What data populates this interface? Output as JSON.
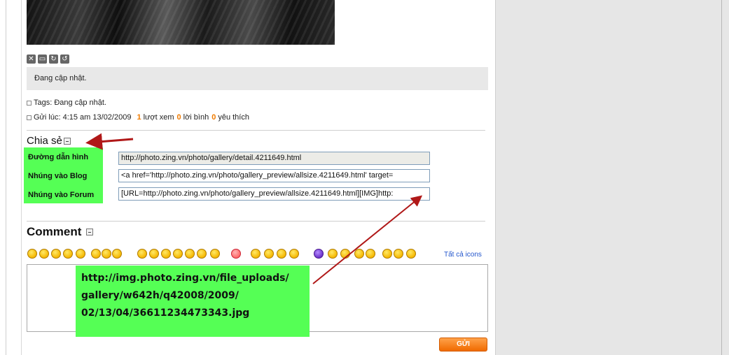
{
  "photo": {
    "description": ""
  },
  "toolbar_icons": [
    "close-icon",
    "image-icon",
    "rotate-icon",
    "refresh-icon"
  ],
  "toolbar_glyphs": [
    "✕",
    "▭",
    "↻",
    "↺"
  ],
  "description": "Đang cập nhật.",
  "tags": "Tags: Đang cập nhật.",
  "posted": {
    "label": "Gửi lúc: 4:15 am 13/02/2009",
    "views_count": "1",
    "views_label": "lượt xem",
    "comments_count": "0",
    "comments_label": "lời bình",
    "likes_count": "0",
    "likes_label": "yêu thích"
  },
  "share": {
    "title": "Chia sẻ",
    "rows": [
      {
        "label": "Đường dẫn hình",
        "value": "http://photo.zing.vn/photo/gallery/detail.4211649.html"
      },
      {
        "label": "Nhúng vào Blog",
        "value": "<a href='http://photo.zing.vn/photo/gallery_preview/allsize.4211649.html' target="
      },
      {
        "label": "Nhúng vào Forum",
        "value": "[URL=http://photo.zing.vn/photo/gallery_preview/allsize.4211649.html][IMG]http:"
      }
    ]
  },
  "comment": {
    "title": "Comment",
    "all_icons": "Tất cả icons",
    "overlay_lines": [
      "http://img.photo.zing.vn/file_uploads/",
      "gallery/w642h/q42008/2009/",
      "02/13/04/36611234473343.jpg"
    ],
    "send_label": "GỬI"
  },
  "colors": {
    "highlight_green": "#55ff55",
    "accent_orange": "#f07b00",
    "arrow_red": "#b01818",
    "link_blue": "#2255cc"
  }
}
